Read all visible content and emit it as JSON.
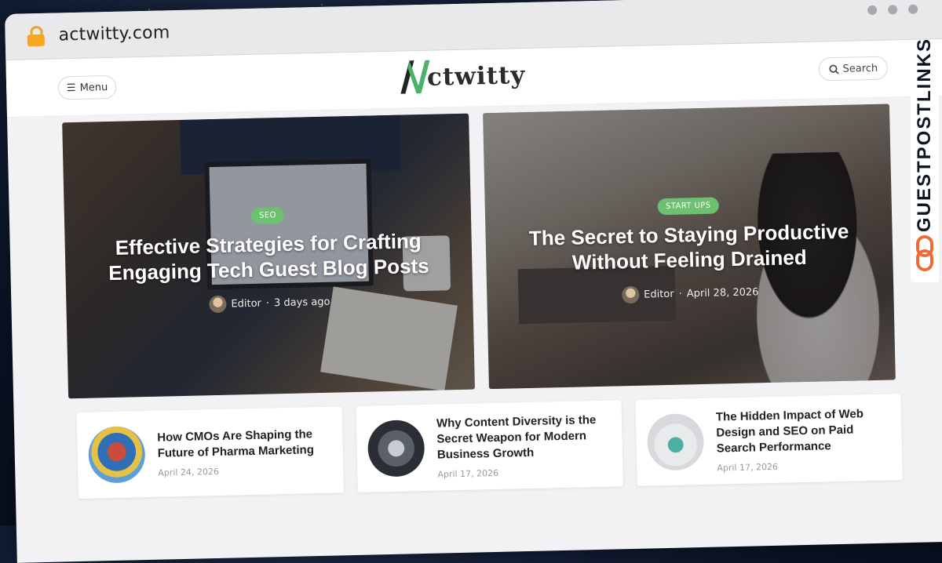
{
  "browser": {
    "url": "actwitty.com"
  },
  "header": {
    "menu_label": "Menu",
    "logo_text": "ctwitty",
    "search_label": "Search"
  },
  "featured": [
    {
      "category": "SEO",
      "title": "Effective Strategies for Crafting Engaging Tech Guest Blog Posts",
      "author": "Editor",
      "date": "3 days ago"
    },
    {
      "category": "START UPS",
      "title": "The Secret to Staying Productive Without Feeling Drained",
      "author": "Editor",
      "date": "April 28, 2026"
    }
  ],
  "posts": [
    {
      "title": "How CMOs Are Shaping the Future of Pharma Marketing",
      "date": "April 24, 2026"
    },
    {
      "title": "Why Content Diversity is the Secret Weapon for Modern Business Growth",
      "date": "April 17, 2026"
    },
    {
      "title": "The Hidden Impact of Web Design and SEO on Paid Search Performance",
      "date": "April 17, 2026"
    }
  ],
  "side_banner": {
    "text": "GUESTPOSTLINKS"
  },
  "colors": {
    "accent_green": "#6cc070",
    "lock_orange": "#f5a623",
    "banner_orange": "#f06a35"
  }
}
